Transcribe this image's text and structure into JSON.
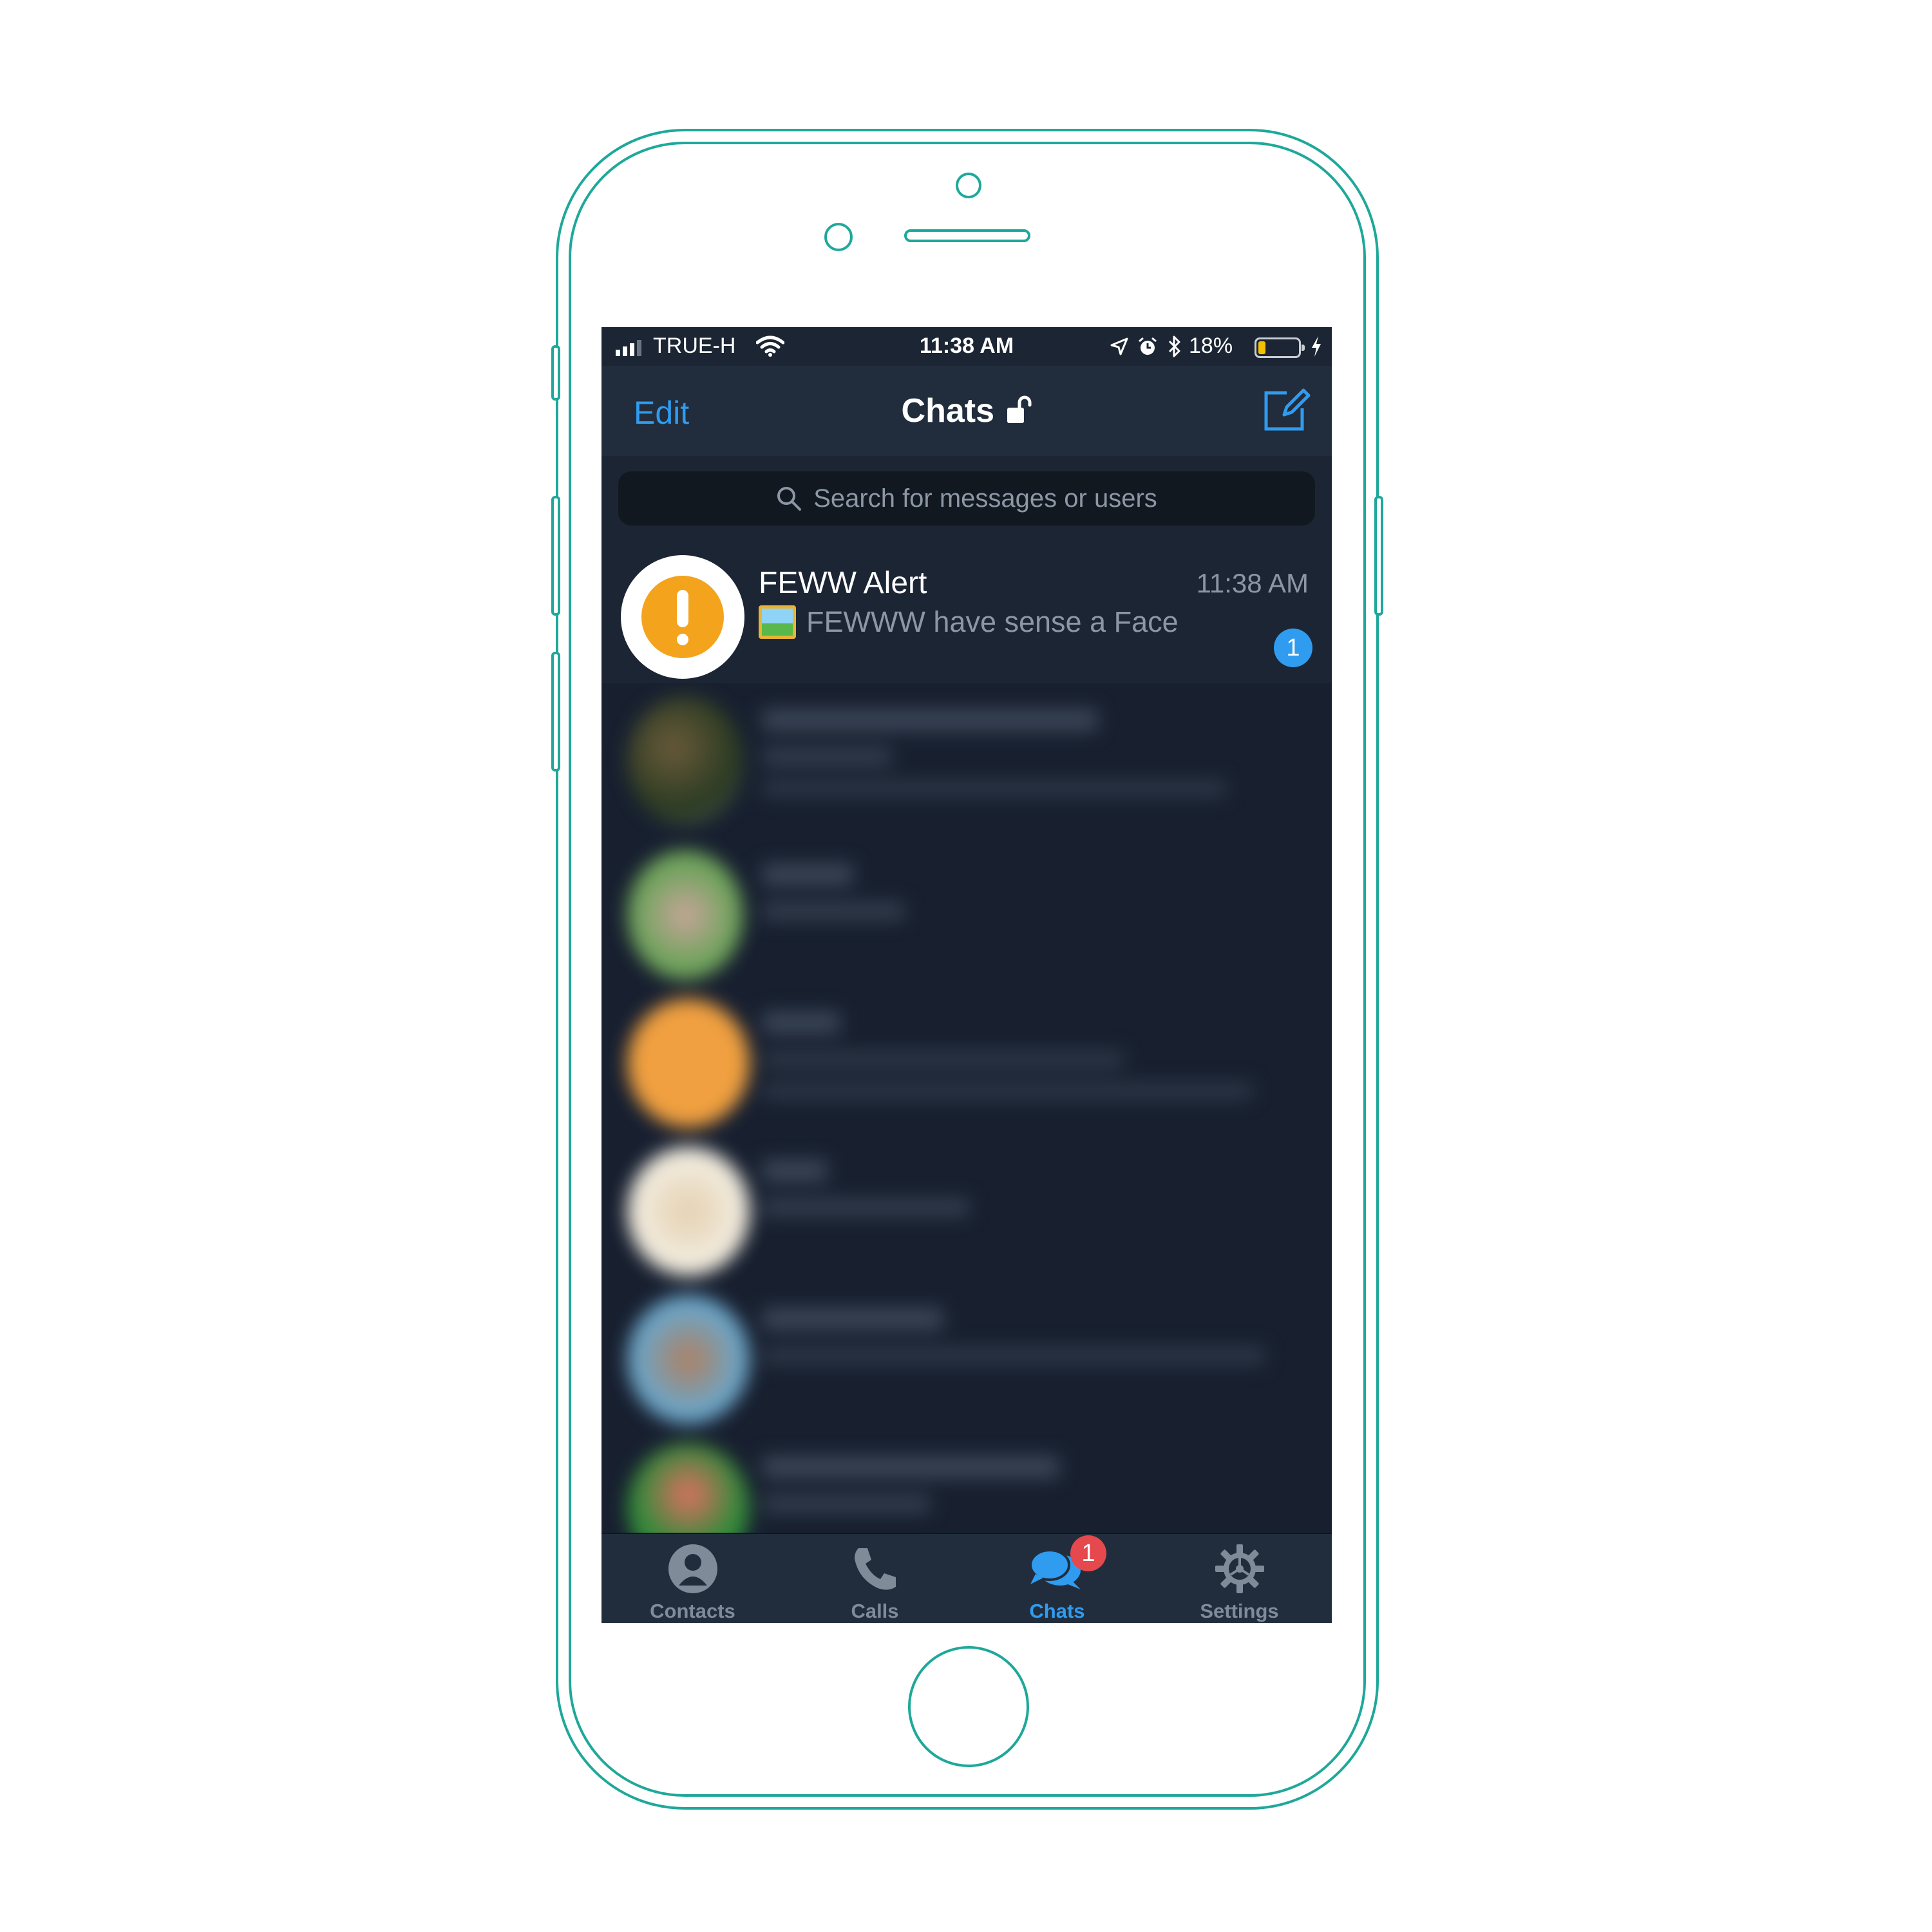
{
  "status_bar": {
    "carrier": "TRUE-H",
    "time": "11:38 AM",
    "battery_percent": "18%",
    "battery_level": 0.18
  },
  "nav": {
    "edit_label": "Edit",
    "title": "Chats"
  },
  "search": {
    "placeholder": "Search for messages or users"
  },
  "chat": {
    "name": "FEWW Alert",
    "time": "11:38 AM",
    "preview": "FEWWW have sense a Face",
    "unread": "1"
  },
  "tabs": [
    {
      "label": "Contacts",
      "icon": "person-icon"
    },
    {
      "label": "Calls",
      "icon": "phone-icon"
    },
    {
      "label": "Chats",
      "icon": "chat-bubbles-icon",
      "badge": "1",
      "active": true
    },
    {
      "label": "Settings",
      "icon": "gear-icon"
    }
  ],
  "colors": {
    "accent": "#2f9cf0",
    "alert_orange": "#f4a31c",
    "badge_red": "#e5484d",
    "device_outline": "#1ea89a"
  }
}
